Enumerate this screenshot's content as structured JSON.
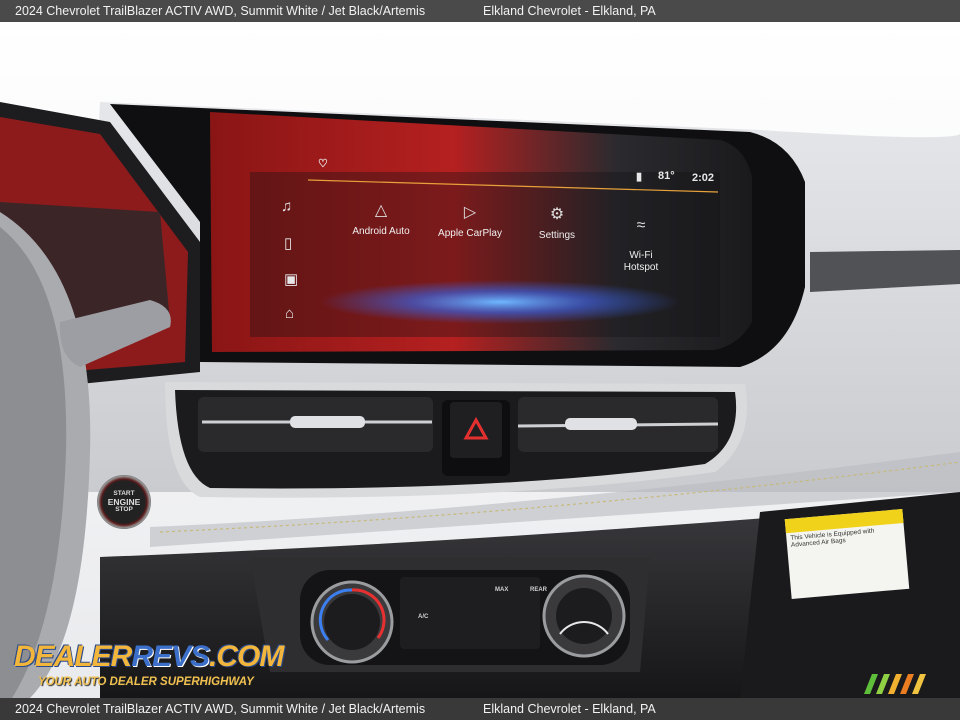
{
  "caption": {
    "vehicle": "2024 Chevrolet TrailBlazer ACTIV AWD,  Summit White / Jet Black/Artemis",
    "dealer": "Elkland Chevrolet - Elkland, PA"
  },
  "infotainment": {
    "temperature": "81°",
    "time": "2:02",
    "apps": [
      {
        "label": "Android Auto",
        "icon": "android-auto-icon"
      },
      {
        "label": "Apple CarPlay",
        "icon": "apple-carplay-icon"
      },
      {
        "label": "Settings",
        "icon": "gear-icon"
      },
      {
        "label": "Wi-Fi\nHotspot",
        "icon": "wifi-hotspot-icon"
      }
    ],
    "side_icons": [
      "music-icon",
      "phone-icon",
      "navigation-icon",
      "home-icon"
    ]
  },
  "engine_button": {
    "line1": "START",
    "line2": "ENGINE",
    "line3": "STOP"
  },
  "climate": {
    "ac_label": "A/C",
    "max_label": "MAX",
    "rear_label": "REAR"
  },
  "sticker": {
    "text": "This Vehicle is Equipped with Advanced Air Bags"
  },
  "watermark": {
    "brand_a": "DEALER",
    "brand_b": "REVS",
    "brand_c": ".COM",
    "tagline": "YOUR AUTO DEALER SUPERHIGHWAY"
  },
  "colors": {
    "accent_orange": "#e8a13a",
    "brand_blue": "#3b6fc9",
    "brand_gold": "#f3b63c"
  }
}
